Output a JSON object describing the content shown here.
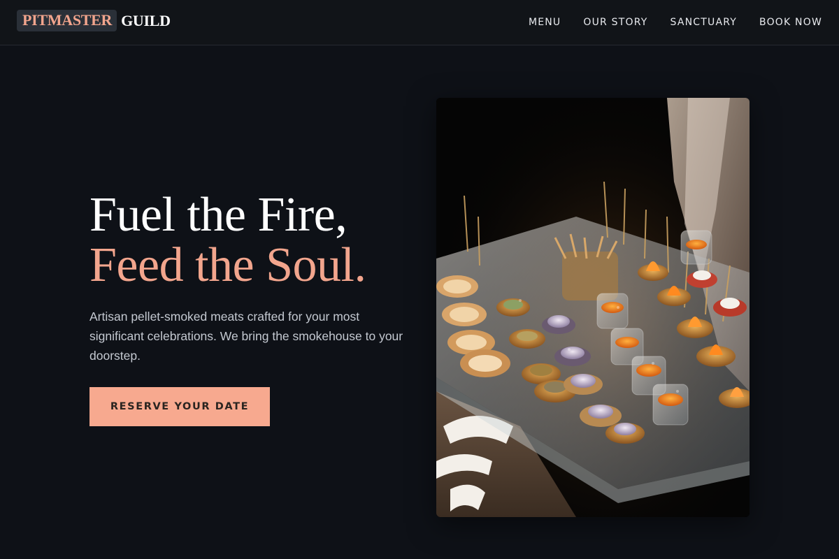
{
  "header": {
    "logo_accent": "PITMASTER",
    "logo_rest": "GUILD",
    "nav": [
      {
        "label": "MENU"
      },
      {
        "label": "OUR STORY"
      },
      {
        "label": "SANCTUARY"
      },
      {
        "label": "BOOK NOW"
      }
    ]
  },
  "hero": {
    "title_line1": "Fuel the Fire,",
    "title_line2": "Feed the Soul.",
    "description": "Artisan pellet-smoked meats crafted for your most significant celebrations. We bring the smokehouse to your doorstep.",
    "cta_label": "RESERVE YOUR DATE",
    "image_alt": "Catering appetizers on a glass platter"
  },
  "colors": {
    "background": "#0e1117",
    "header_bg": "#111418",
    "accent": "#f2a58d",
    "button": "#f7a98f"
  }
}
